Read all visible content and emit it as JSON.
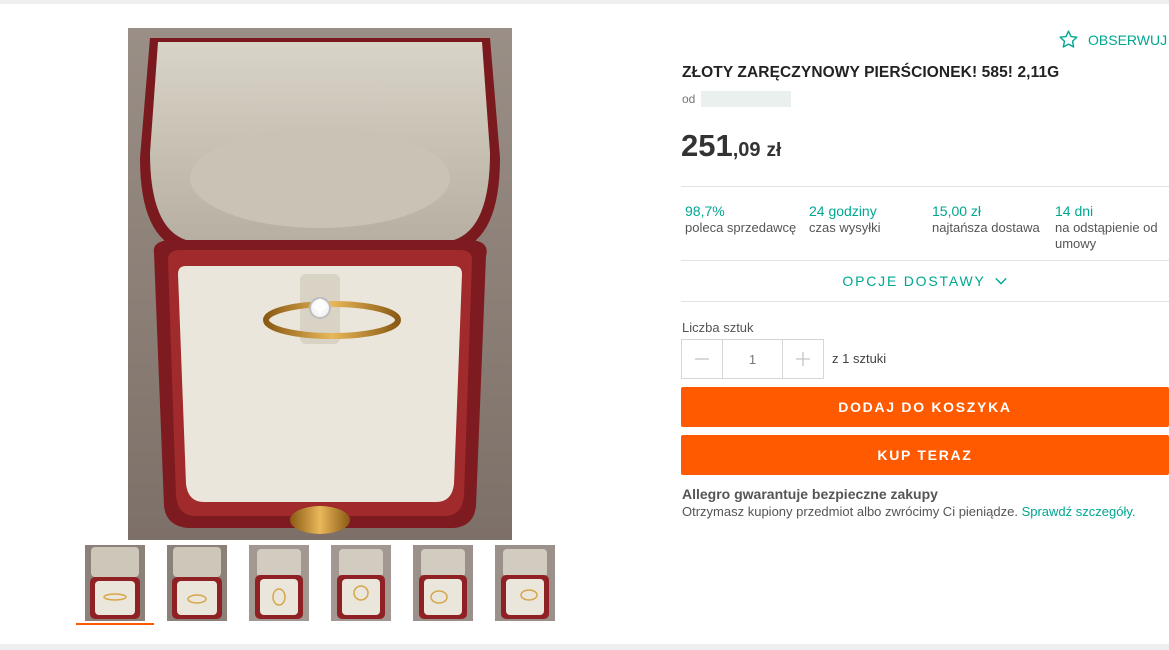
{
  "header": {
    "follow_label": "OBSERWUJ"
  },
  "product": {
    "title": "ZŁOTY ZARĘCZYNOWY PIERŚCIONEK! 585! 2,11G",
    "seller_prefix": "od",
    "price_int": "251",
    "price_dec": ",09",
    "currency": "zł"
  },
  "stats": [
    {
      "value": "98,7%",
      "label": "poleca sprzedawcę"
    },
    {
      "value": "24 godziny",
      "label": "czas wysyłki"
    },
    {
      "value": "15,00 zł",
      "label": "najtańsza dostawa"
    },
    {
      "value": "14 dni",
      "label": "na odstąpienie od umowy"
    }
  ],
  "delivery": {
    "options_label": "OPCJE DOSTAWY"
  },
  "quantity": {
    "label": "Liczba sztuk",
    "value": "1",
    "available": "z 1 sztuki"
  },
  "actions": {
    "add_to_cart": "DODAJ DO KOSZYKA",
    "buy_now": "KUP TERAZ"
  },
  "guarantee": {
    "heading": "Allegro gwarantuje bezpieczne zakupy",
    "text": "Otrzymasz kupiony przedmiot albo zwrócimy Ci pieniądze. ",
    "link": "Sprawdź szczegóły."
  },
  "gallery": {
    "thumbnail_count": 6,
    "active_index": 0
  },
  "colors": {
    "accent": "#00a790",
    "cta": "#ff5a00",
    "price": "#333333"
  }
}
